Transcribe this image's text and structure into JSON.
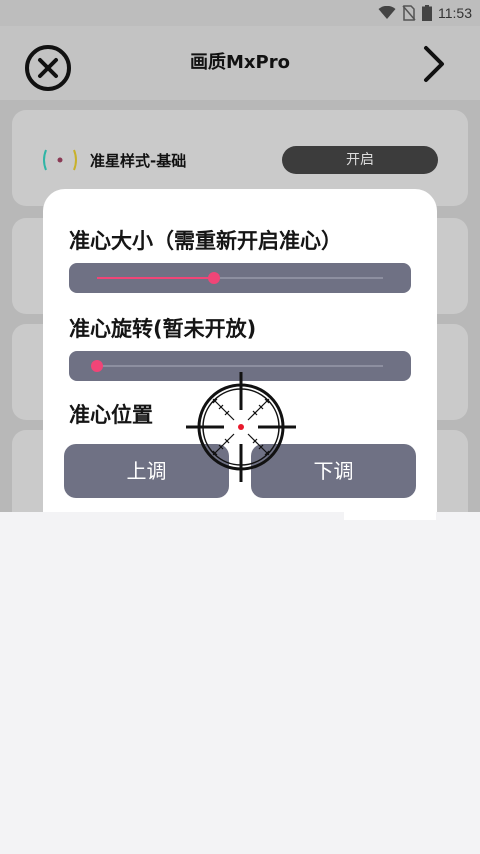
{
  "status_bar": {
    "time": "11:53",
    "icons": [
      "wifi-icon",
      "no-sim-icon",
      "battery-icon"
    ]
  },
  "header": {
    "title": "画质MxPro",
    "close_icon": "close-icon",
    "next_icon": "chevron-right-icon"
  },
  "feature": {
    "label": "准星样式-基础",
    "toggle_label": "开启"
  },
  "dialog": {
    "size_title": "准心大小（需重新开启准心）",
    "size_value": 0.41,
    "rotation_title": "准心旋转(暂未开放)",
    "rotation_value": 0.0,
    "position_title": "准心位置",
    "up_button": "上调",
    "down_button": "下调"
  },
  "colors": {
    "accent": "#f04577",
    "slider_bg": "#6f7184",
    "button_bg": "#6f7184",
    "dim_overlay": "#b8b8b8"
  }
}
